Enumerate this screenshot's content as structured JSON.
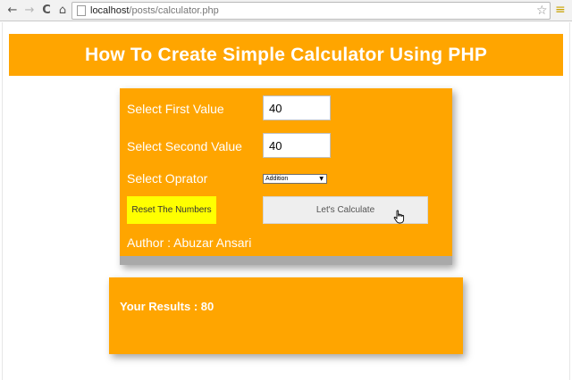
{
  "browser": {
    "back_icon": "←",
    "forward_icon": "→",
    "reload_icon": "C",
    "home_icon": "⌂",
    "url_host": "localhost",
    "url_path": "/posts/calculator.php",
    "star_icon": "☆",
    "menu_icon": "≡"
  },
  "header": {
    "title": "How To Create Simple Calculator Using PHP"
  },
  "form": {
    "first_label": "Select First Value",
    "first_value": "40",
    "second_label": "Select Second Value",
    "second_value": "40",
    "operator_label": "Select Oprator",
    "operator_selected": "Addition",
    "reset_label": "Reset The Numbers",
    "calculate_label": "Let's Calculate",
    "author": "Author : Abuzar Ansari"
  },
  "result": {
    "text": "Your Results : 80"
  },
  "colors": {
    "accent": "#ffa500",
    "reset_button": "#ffff00",
    "footer_bar": "#a9a9a9"
  },
  "icons": [
    "arrow-left-icon",
    "arrow-right-icon",
    "reload-icon",
    "home-icon",
    "page-icon",
    "star-icon",
    "menu-icon",
    "dropdown-arrow-icon",
    "hand-cursor-icon"
  ]
}
